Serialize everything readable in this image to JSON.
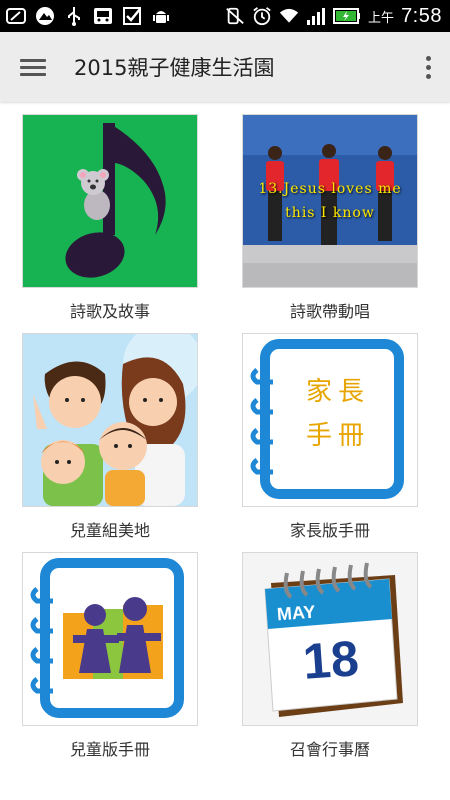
{
  "status_bar": {
    "ampm": "上午",
    "time": "7:58",
    "icons": [
      "feather-icon",
      "mountain-icon",
      "usb-icon",
      "media-icon",
      "checkbox-icon",
      "android-icon",
      "mute-icon",
      "alarm-icon",
      "wifi-icon",
      "signal-icon",
      "battery-icon"
    ],
    "battery_color": "#33b833"
  },
  "action_bar": {
    "title": "2015親子健康生活園",
    "background": "#ececec"
  },
  "tiles": [
    {
      "label": "詩歌及故事"
    },
    {
      "label": "詩歌帶動唱",
      "overlay_line1": "13.Jesus loves me",
      "overlay_line2": "this I know"
    },
    {
      "label": "兒童組美地"
    },
    {
      "label": "家長版手冊",
      "notebook_text1": "家長",
      "notebook_text2": "手冊"
    },
    {
      "label": "兒童版手冊"
    },
    {
      "label": "召會行事曆",
      "calendar_month": "MAY",
      "calendar_day": "18"
    }
  ]
}
